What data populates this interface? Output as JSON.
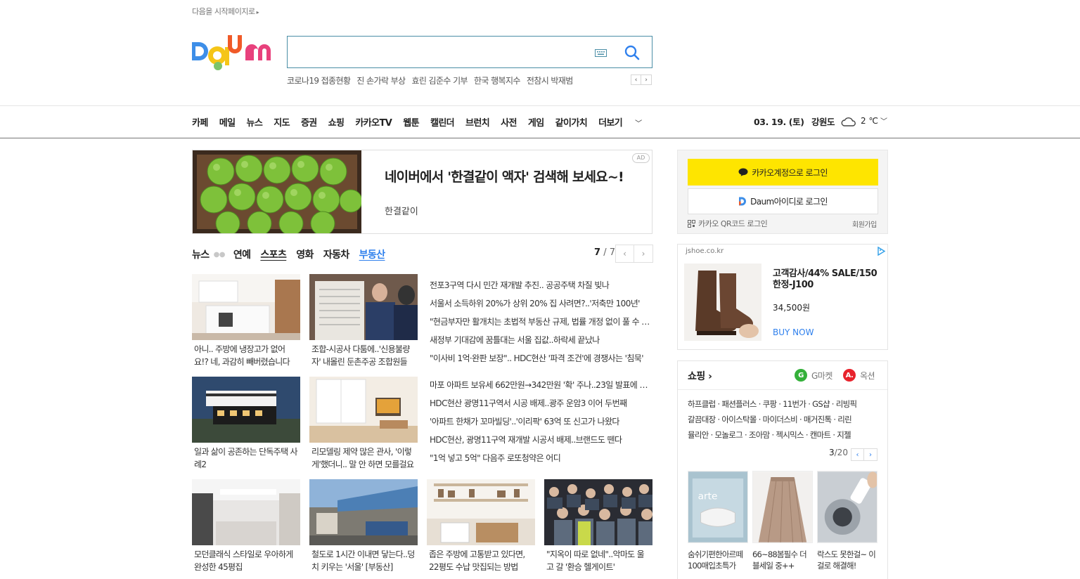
{
  "header": {
    "start_page_link": "다음을 시작페이지로",
    "search_placeholder": "",
    "trending": [
      "코로나19 접종현황",
      "진 손가락 부상",
      "효린 김준수 기부",
      "한국 행복지수",
      "전참시 박재범"
    ]
  },
  "gnb": {
    "items": [
      "카페",
      "메일",
      "뉴스",
      "지도",
      "증권",
      "쇼핑",
      "카카오TV",
      "웹툰",
      "캘린더",
      "브런치",
      "사전",
      "게임",
      "같이가치",
      "더보기"
    ],
    "date": "03. 19. (토)",
    "region": "강원도",
    "temperature": "2 ℃"
  },
  "ad_banner": {
    "title": "네이버에서 '한결같이 액자' 검색해 보세요~!",
    "subtitle": "한결같이",
    "badge": "AD"
  },
  "news": {
    "tabs": [
      "뉴스",
      "연예",
      "스포츠",
      "영화",
      "자동차",
      "부동산"
    ],
    "active_tab": "부동산",
    "page_current": "7",
    "page_total": "/ 7",
    "cards_top": [
      {
        "caption": "아니.. 주방에 냉장고가 없어요!? 네, 과감히 빼버렸습니다"
      },
      {
        "caption": "조합-시공사 다툼에..'신용불량자' 내몰린 둔촌주공 조합원들"
      }
    ],
    "cards_mid": [
      {
        "caption": "일과 삶이 공존하는 단독주택 사례2"
      },
      {
        "caption": "리모델링 제약 많은 관사, '이렇게'했더니.. 말 안 하면 모를걸요"
      }
    ],
    "cards_bottom": [
      {
        "caption": "모던클래식 스타일로 우아하게 완성한 45평집"
      },
      {
        "caption": "철도로 1시간 이내면 닿는다..덩치 키우는 '서울' [부동산]"
      },
      {
        "caption": "좁은 주방에 고통받고 있다면, 22평도 수납 맛집되는 방법"
      },
      {
        "caption": "\"지옥이 따로 없네\"..악마도 울고 갈 '환승 헬게이트'"
      }
    ],
    "headlines_a": [
      "전포3구역 다시 민간 재개발 추진.. 공공주택 차질 빚나",
      "서울서 소득하위 20%가 상위 20% 집 사려면?..'저축만 100년'",
      "\"현금부자만 활개치는 초법적 부동산 규제, 법률 개정 없이 풀 수 있다\"",
      "새정부 기대감에 꿈틀대는 서울 집값..하락세 끝났나",
      "\"이사비 1억·완판 보장\".. HDC현산 '파격 조건'에 경쟁사는 '침묵'"
    ],
    "headlines_b": [
      "마포 아파트 보유세 662만원→342만원 '확' 주나..23일 발표에 촉각",
      "HDC현산 광명11구역서 시공 배제..광주 운암3 이어 두번째",
      "'아파트 한채가 꼬마빌딩'..'이리팍' 63억 또 신고가 나왔다",
      "HDC현산, 광명11구역 재개발 시공서 배제..브랜드도 뗀다",
      "\"1억 넣고 5억\" 다음주 로또청약은 어디"
    ]
  },
  "login": {
    "kakao_label": "카카오계정으로 로그인",
    "daum_label": "Daum아이디로 로그인",
    "qr_label": "카카오 QR코드 로그인",
    "join_label": "회원가입"
  },
  "shop_ad": {
    "domain": "jshoe.co.kr",
    "title": "고객감사/44% SALE/150한정-J100",
    "price": "34,500원",
    "cta": "BUY NOW"
  },
  "shopping": {
    "title": "쇼핑",
    "gmarket": "G마켓",
    "auction": "옥션",
    "link_rows": [
      "하프클럽 · 패션플러스 · 쿠팡 · 11번가 · GS샵 · 리빙픽",
      "갈끔대장 · 아이스탁몰 · 마이더스비 · 매거진톡 · 리린",
      "뮬리안 · 모놀로그 · 조아맘 · 젝시믹스 · 캔마트 · 지젤"
    ],
    "page_current": "3",
    "page_total": "/20",
    "products": [
      {
        "caption": "숨쉬기편한아르떼100매입초특가"
      },
      {
        "caption": "66~88봄필수 더블세일 중++"
      },
      {
        "caption": "락스도 못한걸~ 이걸로 해결해!"
      }
    ]
  },
  "colors": {
    "accent_blue": "#2f80ed",
    "kakao_yellow": "#fee500",
    "search_border": "#4a8ea6"
  }
}
